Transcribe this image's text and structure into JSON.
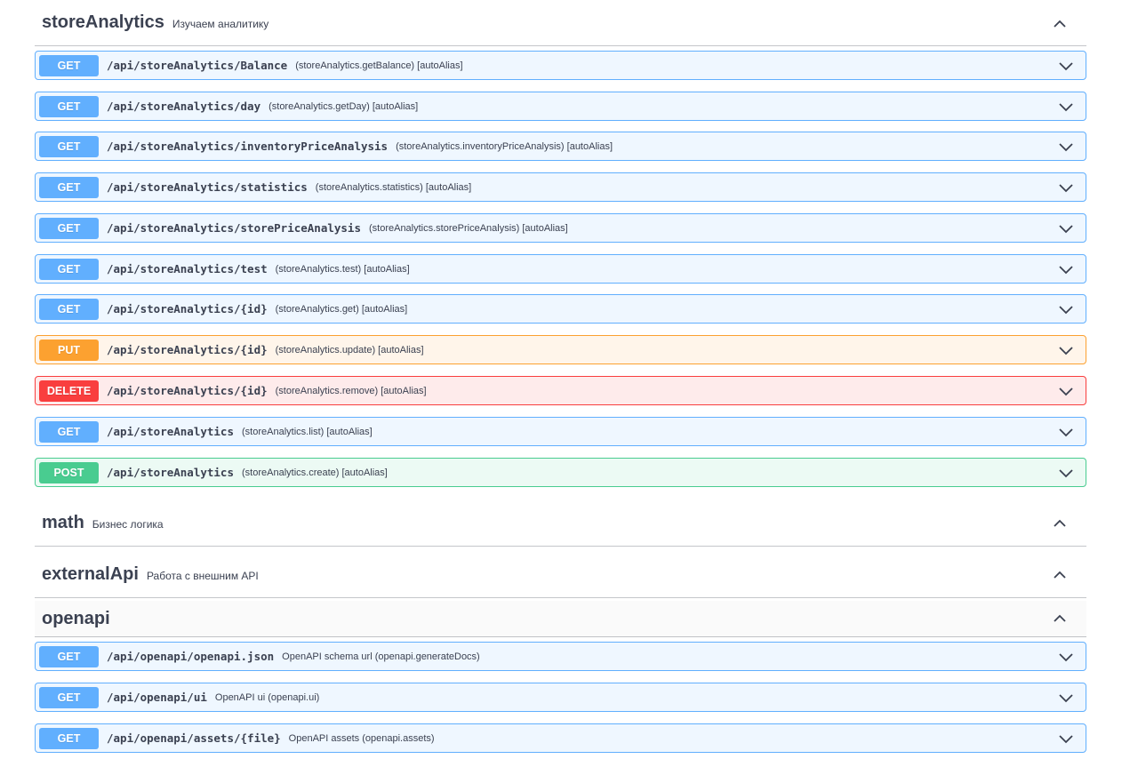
{
  "colors": {
    "get": "#61affe",
    "put": "#fca130",
    "delete": "#f93e3e",
    "post": "#49cc90",
    "text": "#3b4151"
  },
  "sections": [
    {
      "name": "storeAnalytics",
      "description": "Изучаем аналитику",
      "toggle_icon": "chevron-up-icon",
      "operations": [
        {
          "method": "GET",
          "path": "/api/storeAnalytics/Balance",
          "summary": "(storeAnalytics.getBalance) [autoAlias]"
        },
        {
          "method": "GET",
          "path": "/api/storeAnalytics/day",
          "summary": "(storeAnalytics.getDay) [autoAlias]"
        },
        {
          "method": "GET",
          "path": "/api/storeAnalytics/inventoryPriceAnalysis",
          "summary": "(storeAnalytics.inventoryPriceAnalysis) [autoAlias]"
        },
        {
          "method": "GET",
          "path": "/api/storeAnalytics/statistics",
          "summary": "(storeAnalytics.statistics) [autoAlias]"
        },
        {
          "method": "GET",
          "path": "/api/storeAnalytics/storePriceAnalysis",
          "summary": "(storeAnalytics.storePriceAnalysis) [autoAlias]"
        },
        {
          "method": "GET",
          "path": "/api/storeAnalytics/test",
          "summary": "(storeAnalytics.test) [autoAlias]"
        },
        {
          "method": "GET",
          "path": "/api/storeAnalytics/{id}",
          "summary": "(storeAnalytics.get) [autoAlias]"
        },
        {
          "method": "PUT",
          "path": "/api/storeAnalytics/{id}",
          "summary": "(storeAnalytics.update) [autoAlias]"
        },
        {
          "method": "DELETE",
          "path": "/api/storeAnalytics/{id}",
          "summary": "(storeAnalytics.remove) [autoAlias]"
        },
        {
          "method": "GET",
          "path": "/api/storeAnalytics",
          "summary": "(storeAnalytics.list) [autoAlias]"
        },
        {
          "method": "POST",
          "path": "/api/storeAnalytics",
          "summary": "(storeAnalytics.create) [autoAlias]"
        }
      ]
    },
    {
      "name": "math",
      "description": "Бизнес логика",
      "toggle_icon": "chevron-up-icon",
      "operations": []
    },
    {
      "name": "externalApi",
      "description": "Работа с внешним API",
      "toggle_icon": "chevron-up-icon",
      "operations": []
    },
    {
      "name": "openapi",
      "description": "",
      "toggle_icon": "chevron-up-icon",
      "operations": [
        {
          "method": "GET",
          "path": "/api/openapi/openapi.json",
          "summary": "OpenAPI schema url (openapi.generateDocs)"
        },
        {
          "method": "GET",
          "path": "/api/openapi/ui",
          "summary": "OpenAPI ui (openapi.ui)"
        },
        {
          "method": "GET",
          "path": "/api/openapi/assets/{file}",
          "summary": "OpenAPI assets (openapi.assets)"
        }
      ]
    }
  ],
  "operation_toggle_icon": "chevron-down-icon"
}
